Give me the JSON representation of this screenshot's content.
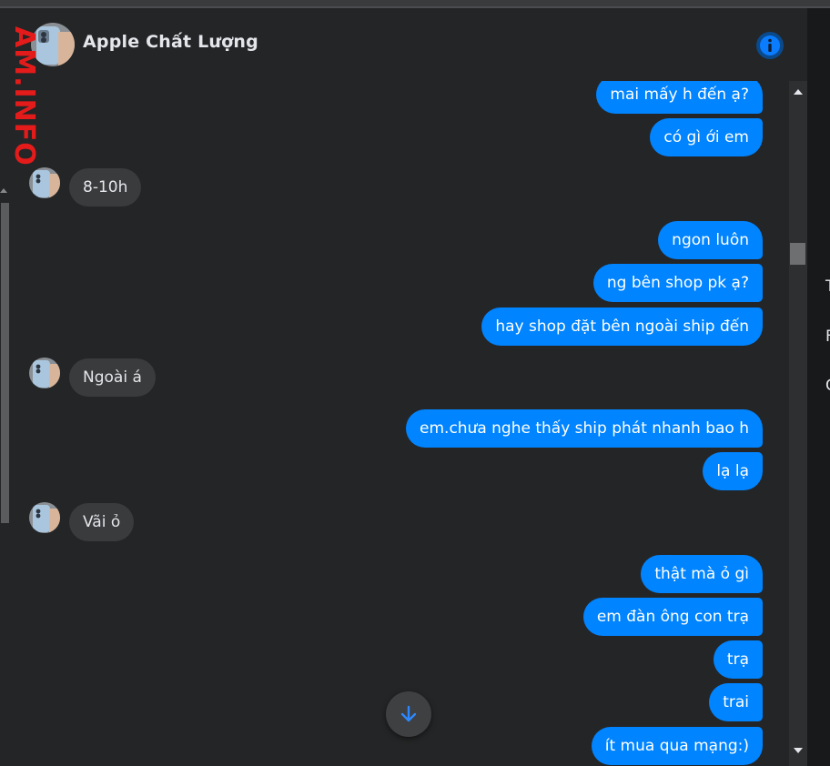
{
  "conversation": {
    "title": "Apple Chất Lượng",
    "watermark": "AM.INFO"
  },
  "icons": {
    "info": "info-icon",
    "scroll_to_bottom": "arrow-down-icon",
    "avatar": "contact-avatar"
  },
  "colors": {
    "accent": "#0084ff",
    "incoming_bubble": "#3a3b3c",
    "panel_bg": "#242526",
    "watermark": "#e41b1b"
  },
  "messages": [
    {
      "from": "me",
      "text": "mai mấy h đến ạ?"
    },
    {
      "from": "me",
      "text": "có gì ới em"
    },
    {
      "from": "contact",
      "text": "8-10h"
    },
    {
      "from": "me",
      "text": "ngon luôn"
    },
    {
      "from": "me",
      "text": "ng bên shop pk ạ?"
    },
    {
      "from": "me",
      "text": "hay shop đặt bên ngoài ship đến"
    },
    {
      "from": "contact",
      "text": "Ngoài á"
    },
    {
      "from": "me",
      "text": "em.chưa nghe thấy ship phát nhanh bao h"
    },
    {
      "from": "me",
      "text": "lạ lạ"
    },
    {
      "from": "contact",
      "text": "Vãi ỏ"
    },
    {
      "from": "me",
      "text": "thật mà ỏ gì"
    },
    {
      "from": "me",
      "text": "em đàn ông con trạ"
    },
    {
      "from": "me",
      "text": "trạ"
    },
    {
      "from": "me",
      "text": "trai"
    },
    {
      "from": "me",
      "text": "ít mua qua mạng:)"
    }
  ],
  "right_panel_fragments": [
    "T",
    "F",
    "C"
  ]
}
